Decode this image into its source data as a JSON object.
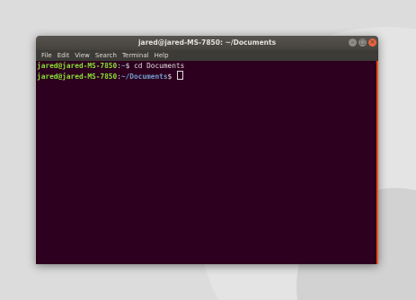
{
  "window": {
    "title": "jared@jared-MS-7850: ~/Documents",
    "buttons": {
      "minimize": "–",
      "maximize": "□",
      "close": "×"
    }
  },
  "menu": [
    "File",
    "Edit",
    "View",
    "Search",
    "Terminal",
    "Help"
  ],
  "terminal": {
    "lines": [
      {
        "user_host": "jared@jared-MS-7850",
        "separator": ":",
        "path": "~",
        "prompt_symbol": "$ ",
        "command": "cd Documents"
      },
      {
        "user_host": "jared@jared-MS-7850",
        "separator": ":",
        "path": "~/Documents",
        "prompt_symbol": "$ ",
        "command": ""
      }
    ]
  },
  "colors": {
    "terminal_bg": "#2c001e",
    "user_host": "#8ae234",
    "path": "#729fcf",
    "accent": "#e95420"
  }
}
